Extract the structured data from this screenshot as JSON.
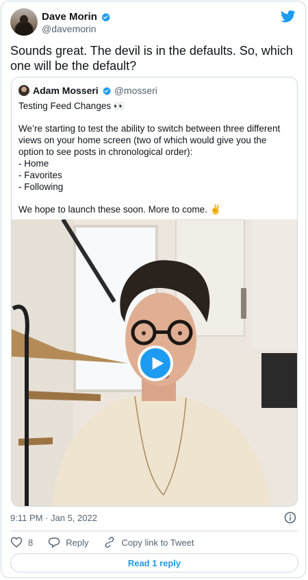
{
  "tweet": {
    "author_name": "Dave Morin",
    "author_handle": "@davemorin",
    "text": "Sounds great. The devil is in the defaults. So, which one will be the default?",
    "timestamp": "9:11 PM · Jan 5, 2022"
  },
  "quoted_tweet": {
    "author_name": "Adam Mosseri",
    "author_handle": "@mosseri",
    "title": "Testing Feed Changes 👀",
    "paragraph": "We’re starting to test the ability to switch between three different views on your home screen (two of which would give you the option to see posts in chronological order):",
    "list": [
      "- Home",
      "- Favorites",
      "- Following"
    ],
    "closing": "We hope to launch these soon. More to come. ✌️"
  },
  "actions": {
    "like_count": "8",
    "reply_label": "Reply",
    "copy_link_label": "Copy link to Tweet"
  },
  "read_replies_label": "Read 1 reply",
  "colors": {
    "accent": "#1d9bf0",
    "text": "#0f1419",
    "muted": "#536471",
    "border": "#cfd9de"
  },
  "icons": [
    "verified-badge-icon",
    "twitter-bird-icon",
    "play-icon",
    "info-icon",
    "heart-icon",
    "reply-icon",
    "link-icon"
  ]
}
